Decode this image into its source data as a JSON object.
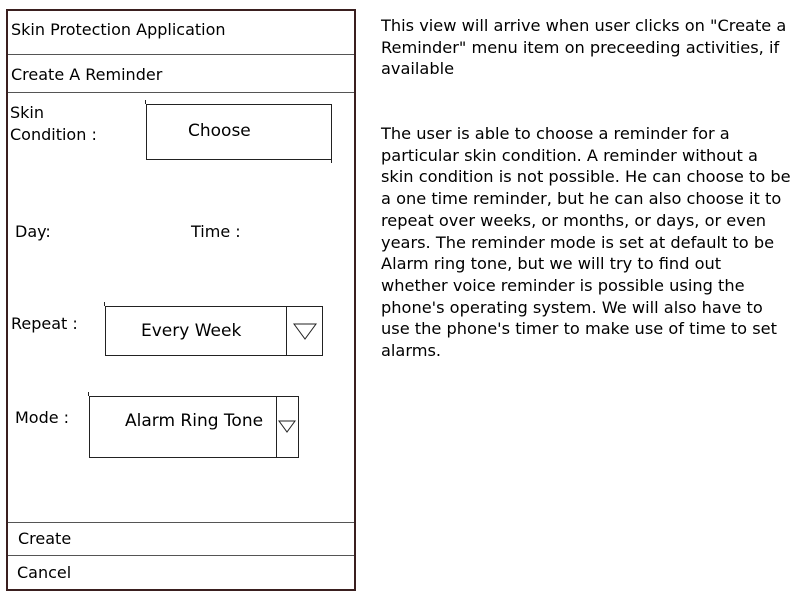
{
  "app": {
    "title": "Skin Protection Application",
    "screen_title": "Create A Reminder"
  },
  "form": {
    "skin_condition_label_line1": "Skin",
    "skin_condition_label_line2": "Condition :",
    "choose_button_label": "Choose",
    "day_label": "Day:",
    "time_label": "Time :",
    "repeat_label": "Repeat :",
    "repeat_value": "Every Week",
    "mode_label": "Mode :",
    "mode_value": "Alarm Ring Tone"
  },
  "actions": {
    "create_label": "Create",
    "cancel_label": "Cancel"
  },
  "notes": {
    "note1": "This view will arrive when user clicks on \"Create a Reminder\" menu item on preceeding activities, if available",
    "note2": "The user is able to choose a reminder for a particular skin condition. A reminder without a skin condition is not possible. He can choose to be a one time reminder, but he can also choose it to repeat over weeks, or months, or days, or even years. The reminder mode is set at default to be Alarm ring tone, but we will try to find out whether voice reminder is possible using the phone's operating system. We will also have to use the phone's timer to make use of time to set alarms."
  },
  "icons": {
    "dropdown": "triangle-down-icon"
  }
}
